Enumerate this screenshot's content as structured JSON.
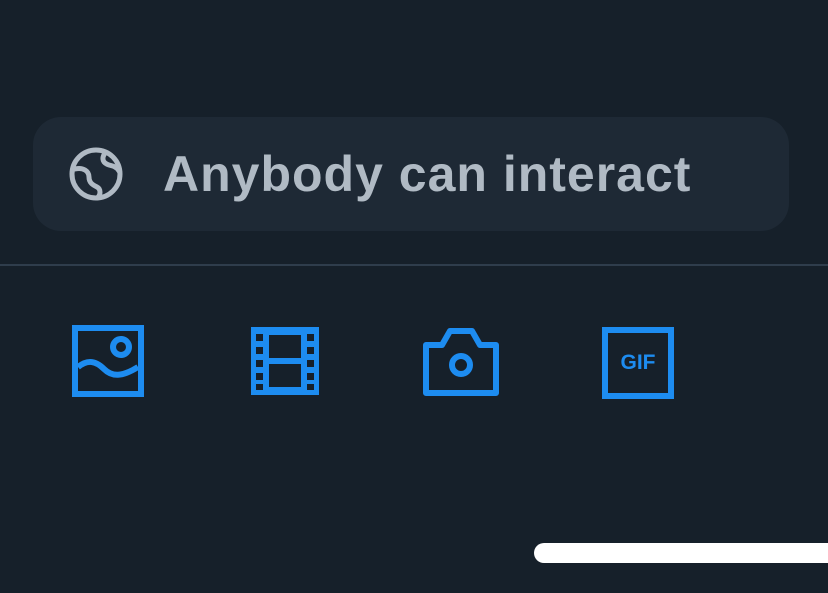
{
  "audience": {
    "label": "Anybody can interact",
    "icon": "globe-icon"
  },
  "toolbar": {
    "items": [
      {
        "icon": "image-icon",
        "label": ""
      },
      {
        "icon": "video-icon",
        "label": ""
      },
      {
        "icon": "camera-icon",
        "label": ""
      },
      {
        "icon": "gif-icon",
        "label": "GIF"
      }
    ]
  },
  "colors": {
    "background": "#16202a",
    "pill": "#1e2935",
    "muted_text": "#b0bac4",
    "accent": "#1d8cf0",
    "divider": "#2f3d4c"
  }
}
